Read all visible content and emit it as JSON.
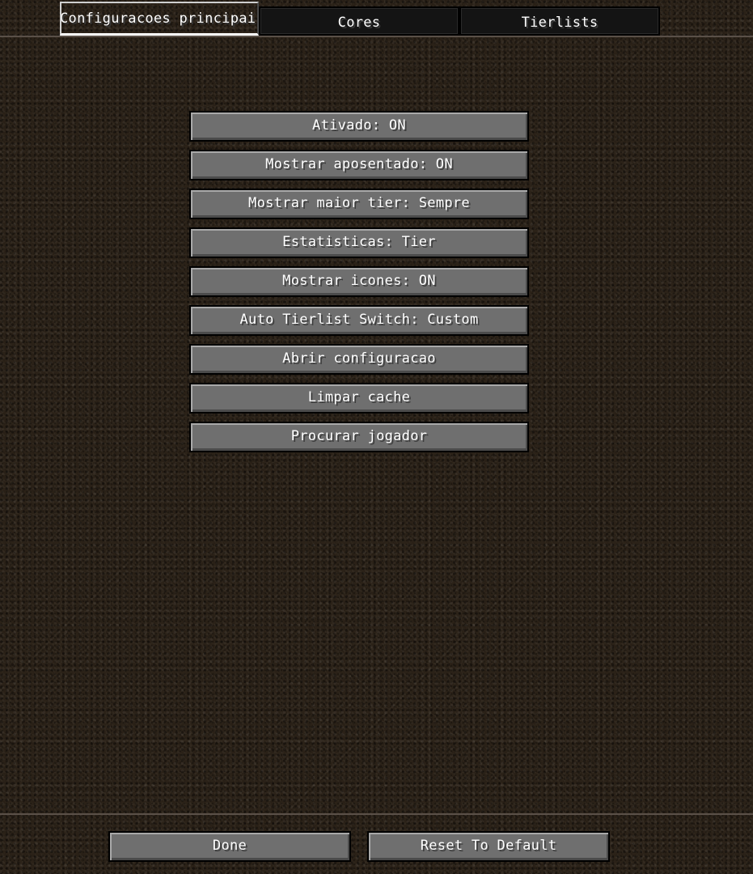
{
  "tabs": [
    {
      "label": "Configuracoes principais",
      "active": true
    },
    {
      "label": "Cores",
      "active": false
    },
    {
      "label": "Tierlists",
      "active": false
    }
  ],
  "options": [
    {
      "label": "Ativado: ON"
    },
    {
      "label": "Mostrar aposentado: ON"
    },
    {
      "label": "Mostrar maior tier: Sempre"
    },
    {
      "label": "Estatisticas: Tier"
    },
    {
      "label": "Mostrar icones: ON"
    },
    {
      "label": "Auto Tierlist Switch: Custom"
    },
    {
      "label": "Abrir configuracao"
    },
    {
      "label": "Limpar cache"
    },
    {
      "label": "Procurar jogador"
    }
  ],
  "footer": {
    "done_label": "Done",
    "reset_label": "Reset To Default"
  }
}
